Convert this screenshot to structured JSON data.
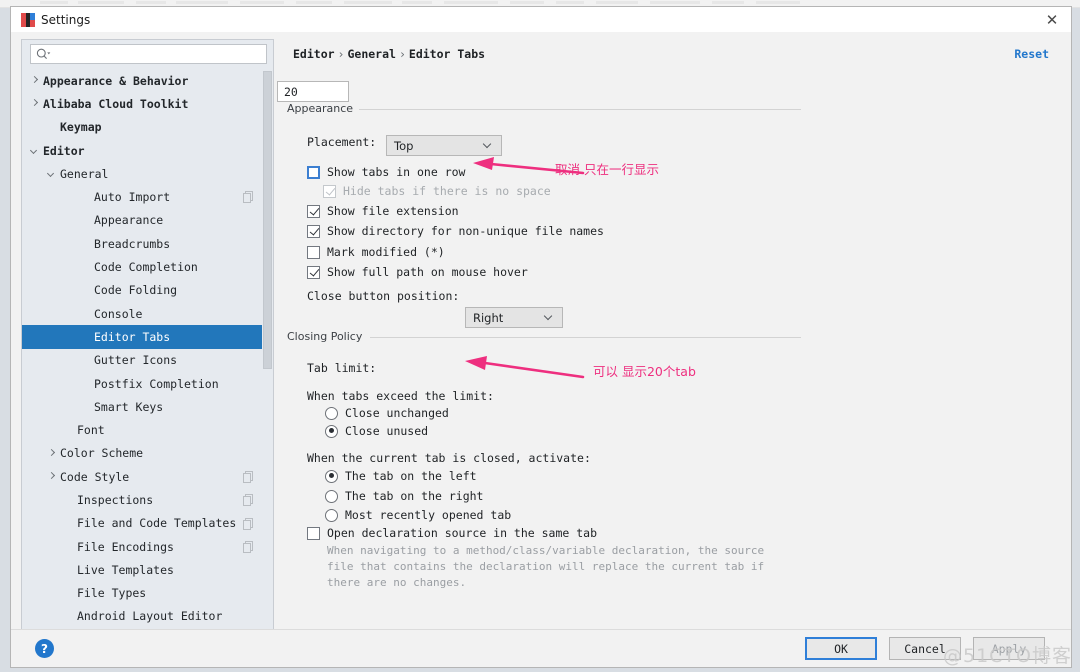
{
  "window": {
    "title": "Settings",
    "app_icon": "intellij-idea-icon",
    "close_icon": "close-icon"
  },
  "search": {
    "value": "",
    "placeholder": "",
    "icon": "search-icon"
  },
  "sidebar": {
    "items": [
      {
        "label": "Appearance & Behavior",
        "indent": 0,
        "arrow": "right",
        "bold": true,
        "selected": false,
        "badge": false
      },
      {
        "label": "Alibaba Cloud Toolkit",
        "indent": 0,
        "arrow": "right",
        "bold": true,
        "selected": false,
        "badge": false
      },
      {
        "label": "Keymap",
        "indent": 1,
        "arrow": "none",
        "bold": true,
        "selected": false,
        "badge": false
      },
      {
        "label": "Editor",
        "indent": 0,
        "arrow": "down",
        "bold": true,
        "selected": false,
        "badge": false
      },
      {
        "label": "General",
        "indent": 1,
        "arrow": "down",
        "bold": false,
        "selected": false,
        "badge": false
      },
      {
        "label": "Auto Import",
        "indent": 3,
        "arrow": "none",
        "bold": false,
        "selected": false,
        "badge": true
      },
      {
        "label": "Appearance",
        "indent": 3,
        "arrow": "none",
        "bold": false,
        "selected": false,
        "badge": false
      },
      {
        "label": "Breadcrumbs",
        "indent": 3,
        "arrow": "none",
        "bold": false,
        "selected": false,
        "badge": false
      },
      {
        "label": "Code Completion",
        "indent": 3,
        "arrow": "none",
        "bold": false,
        "selected": false,
        "badge": false
      },
      {
        "label": "Code Folding",
        "indent": 3,
        "arrow": "none",
        "bold": false,
        "selected": false,
        "badge": false
      },
      {
        "label": "Console",
        "indent": 3,
        "arrow": "none",
        "bold": false,
        "selected": false,
        "badge": false
      },
      {
        "label": "Editor Tabs",
        "indent": 3,
        "arrow": "none",
        "bold": false,
        "selected": true,
        "badge": false
      },
      {
        "label": "Gutter Icons",
        "indent": 3,
        "arrow": "none",
        "bold": false,
        "selected": false,
        "badge": false
      },
      {
        "label": "Postfix Completion",
        "indent": 3,
        "arrow": "none",
        "bold": false,
        "selected": false,
        "badge": false
      },
      {
        "label": "Smart Keys",
        "indent": 3,
        "arrow": "none",
        "bold": false,
        "selected": false,
        "badge": false
      },
      {
        "label": "Font",
        "indent": 2,
        "arrow": "none",
        "bold": false,
        "selected": false,
        "badge": false
      },
      {
        "label": "Color Scheme",
        "indent": 1,
        "arrow": "right",
        "bold": false,
        "selected": false,
        "badge": false
      },
      {
        "label": "Code Style",
        "indent": 1,
        "arrow": "right",
        "bold": false,
        "selected": false,
        "badge": true
      },
      {
        "label": "Inspections",
        "indent": 2,
        "arrow": "none",
        "bold": false,
        "selected": false,
        "badge": true
      },
      {
        "label": "File and Code Templates",
        "indent": 2,
        "arrow": "none",
        "bold": false,
        "selected": false,
        "badge": true
      },
      {
        "label": "File Encodings",
        "indent": 2,
        "arrow": "none",
        "bold": false,
        "selected": false,
        "badge": true
      },
      {
        "label": "Live Templates",
        "indent": 2,
        "arrow": "none",
        "bold": false,
        "selected": false,
        "badge": false
      },
      {
        "label": "File Types",
        "indent": 2,
        "arrow": "none",
        "bold": false,
        "selected": false,
        "badge": false
      },
      {
        "label": "Android Layout Editor",
        "indent": 2,
        "arrow": "none",
        "bold": false,
        "selected": false,
        "badge": false
      }
    ]
  },
  "content": {
    "breadcrumb": {
      "root": "Editor",
      "mid": "General",
      "leaf": "Editor Tabs",
      "separator": "›"
    },
    "reset_label": "Reset",
    "appearance": {
      "group_label": "Appearance",
      "placement_label": "Placement:",
      "placement_value": "Top",
      "checkboxes": [
        {
          "label": "Show tabs in one row",
          "checked": false,
          "disabled": false,
          "focused": true
        },
        {
          "label": "Hide tabs if there is no space",
          "checked": true,
          "disabled": true,
          "focused": false
        },
        {
          "label": "Show file extension",
          "checked": true,
          "disabled": false,
          "focused": false
        },
        {
          "label": "Show directory for non-unique file names",
          "checked": true,
          "disabled": false,
          "focused": false
        },
        {
          "label": "Mark modified (*)",
          "checked": false,
          "disabled": false,
          "focused": false
        },
        {
          "label": "Show full path on mouse hover",
          "checked": true,
          "disabled": false,
          "focused": false
        }
      ],
      "close_button_label": "Close button position:",
      "close_button_value": "Right"
    },
    "closing_policy": {
      "group_label": "Closing Policy",
      "tab_limit_label": "Tab limit:",
      "tab_limit_value": "20",
      "exceed_label": "When tabs exceed the limit:",
      "exceed_options": [
        {
          "label": "Close unchanged",
          "checked": false
        },
        {
          "label": "Close unused",
          "checked": true
        }
      ],
      "activate_label": "When the current tab is closed, activate:",
      "activate_options": [
        {
          "label": "The tab on the left",
          "checked": true
        },
        {
          "label": "The tab on the right",
          "checked": false
        },
        {
          "label": "Most recently opened tab",
          "checked": false
        }
      ],
      "open_decl_label": "Open declaration source in the same tab",
      "open_decl_checked": false,
      "open_decl_desc_1": "When navigating to a method/class/variable declaration, the source",
      "open_decl_desc_2": "file that contains the declaration will replace the current tab if",
      "open_decl_desc_3": "there are no changes."
    }
  },
  "annotations": {
    "color": "#ee2f7f",
    "items": [
      {
        "text": "取消 只在一行显示",
        "name": "annotation-show-tabs-one-row"
      },
      {
        "text": "可以 显示20个tab",
        "name": "annotation-tab-limit"
      }
    ]
  },
  "footer": {
    "help_icon": "help-icon",
    "help_glyph": "?",
    "buttons": [
      {
        "label": "OK",
        "primary": true,
        "disabled": false
      },
      {
        "label": "Cancel",
        "primary": false,
        "disabled": false
      },
      {
        "label": "Apply",
        "primary": false,
        "disabled": true
      }
    ]
  },
  "watermark": {
    "text": "@51CTO博客"
  }
}
